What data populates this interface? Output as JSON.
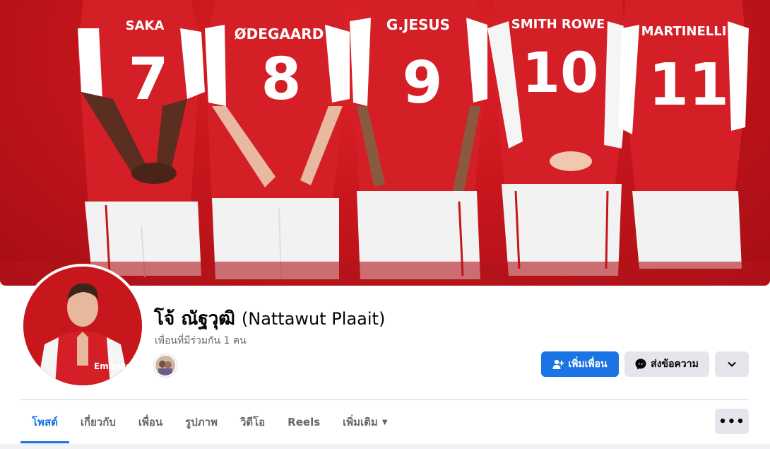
{
  "cover": {
    "players": [
      {
        "name": "SAKA",
        "number": "7"
      },
      {
        "name": "ØDEGAARD",
        "number": "8"
      },
      {
        "name": "G.JESUS",
        "number": "9"
      },
      {
        "name": "SMITH ROWE",
        "number": "10"
      },
      {
        "name": "MARTINELLI",
        "number": "11"
      }
    ]
  },
  "profile": {
    "name": "โจ้ ณัฐวุฒิ",
    "alt_name": "(Nattawut Plaait)",
    "mutual_friends": "เพื่อนที่มีร่วมกัน 1 คน",
    "avatar_shirt_text": "Emirates"
  },
  "actions": {
    "add_friend": "เพิ่มเพื่อน",
    "message": "ส่งข้อความ",
    "more_icon": "chevron-down-icon"
  },
  "tabs": [
    {
      "label": "โพสต์",
      "active": true
    },
    {
      "label": "เกี่ยวกับ"
    },
    {
      "label": "เพื่อน"
    },
    {
      "label": "รูปภาพ"
    },
    {
      "label": "วิดีโอ"
    },
    {
      "label": "Reels"
    },
    {
      "label": "เพิ่มเติม"
    }
  ],
  "colors": {
    "accent": "#1b74e4",
    "cover_red": "#c8161d",
    "button_gray": "#e4e6eb"
  }
}
